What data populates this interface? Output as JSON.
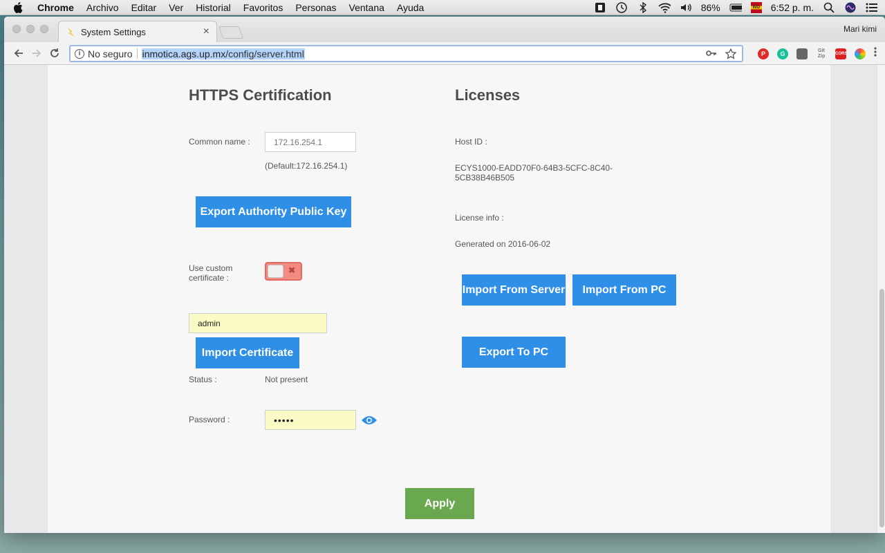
{
  "menubar": {
    "app": "Chrome",
    "items": [
      "Archivo",
      "Editar",
      "Ver",
      "Historial",
      "Favoritos",
      "Personas",
      "Ventana",
      "Ayuda"
    ],
    "battery": "86%",
    "flag_label": "ISO",
    "clock": "6:52 p. m."
  },
  "browser": {
    "tab_title": "System Settings",
    "tab_close": "×",
    "profile": "Mari kimi",
    "security_label": "No seguro",
    "url_host": "inmotica.ags.up.mx",
    "url_path": "/config/server.html",
    "info_glyph": "i",
    "ext_labels": [
      "P",
      "G",
      "",
      "Git Zip",
      "CORS",
      ""
    ]
  },
  "https": {
    "title": "HTTPS Certification",
    "common_name_label": "Common name :",
    "common_name_placeholder": "172.16.254.1",
    "default_hint": "(Default:172.16.254.1)",
    "export_key_button": "Export Authority Public Key",
    "custom_cert_label": "Use custom certificate :",
    "custom_cert_enabled": false,
    "cert_name_value": "admin",
    "import_cert_button": "Import Certificate",
    "status_label": "Status :",
    "status_value": "Not present",
    "password_label": "Password :",
    "password_value": "•••••"
  },
  "licenses": {
    "title": "Licenses",
    "host_id_label": "Host ID :",
    "host_id_value_line1": "ECYS1000-EADD70F0-64B3-5CFC-8C40-",
    "host_id_value_line2": "5CB38B46B505",
    "license_info_label": "License info :",
    "license_info_value": "Generated on 2016-06-02",
    "import_server_button": "Import From Server",
    "import_pc_button": "Import From PC",
    "export_pc_button": "Export To PC"
  },
  "apply_button": "Apply",
  "colors": {
    "primary_button": "#2f8fe6",
    "apply_button": "#6aa84f",
    "toggle_off": "#f28b82",
    "autofill": "#fbfcc5"
  }
}
